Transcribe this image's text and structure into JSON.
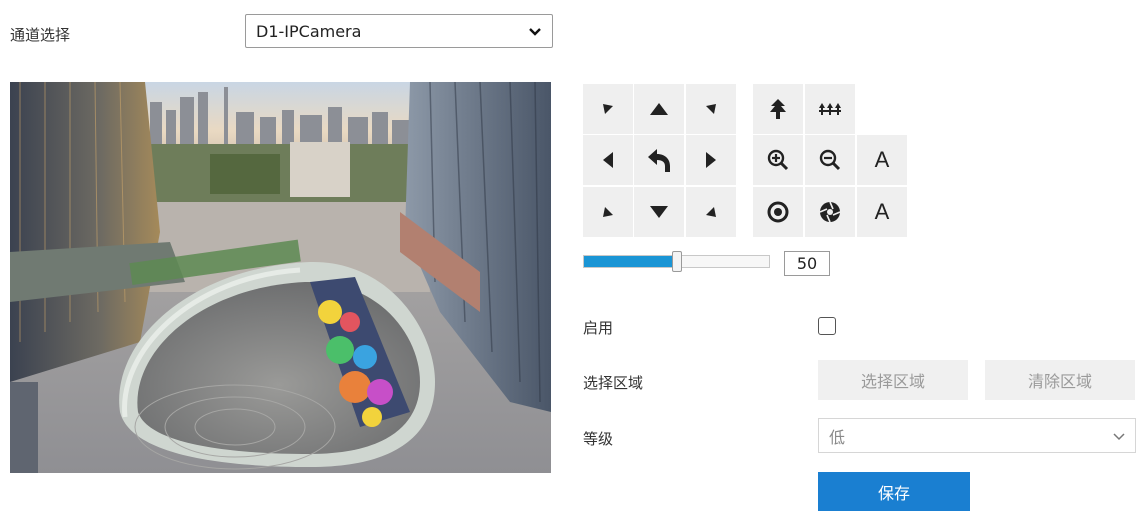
{
  "channel": {
    "label": "通道选择",
    "selected": "D1-IPCamera"
  },
  "ptz": {
    "speed_value": "50",
    "speed_fraction": 0.5,
    "focus_letter": "A",
    "iris_letter": "A"
  },
  "form": {
    "enable_label": "启用",
    "enable_checked": false,
    "region_label": "选择区域",
    "select_region_button": "选择区域",
    "clear_region_button": "清除区域",
    "level_label": "等级",
    "level_value": "低",
    "save_button": "保存"
  },
  "colors": {
    "accent": "#1a95d5",
    "save": "#1a7fd1"
  }
}
